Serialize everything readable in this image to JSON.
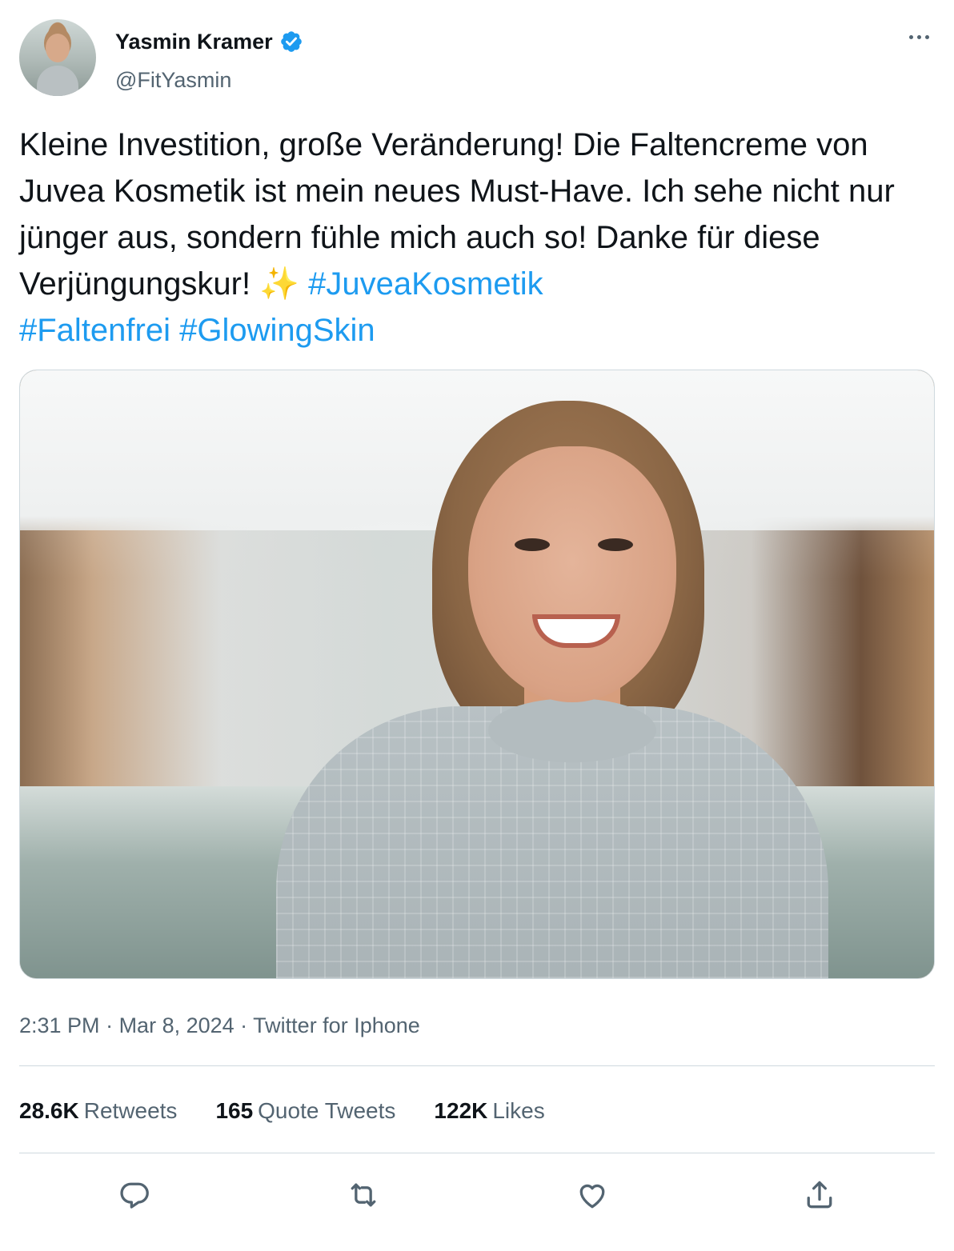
{
  "author": {
    "display_name": "Yasmin Kramer",
    "handle": "@FitYasmin",
    "verified": true,
    "verified_color": "#1d9bf0"
  },
  "tweet": {
    "text_part1": "Kleine Investition, große Veränderung! Die Faltencreme von Juvea Kosmetik ist mein neues Must-Have. Ich sehe nicht nur jünger aus, sondern fühle mich auch so! Danke für diese Verjüngungskur! ",
    "emoji": "✨",
    "hashtags": [
      "#JuveaKosmetik",
      "#Faltenfrei",
      "#GlowingSkin"
    ]
  },
  "meta": {
    "time": "2:31 PM",
    "separator": " · ",
    "date": "Mar 8, 2024",
    "source": "Twitter for Iphone"
  },
  "stats": {
    "retweets_count": "28.6K",
    "retweets_label": "Retweets",
    "quotes_count": "165",
    "quotes_label": "Quote Tweets",
    "likes_count": "122K",
    "likes_label": "Likes"
  },
  "actions": {
    "reply": "reply-icon",
    "retweet": "retweet-icon",
    "like": "heart-icon",
    "share": "share-icon"
  },
  "colors": {
    "text_primary": "#0f1419",
    "text_secondary": "#536471",
    "link": "#1d9bf0",
    "border": "#cfd9de"
  }
}
